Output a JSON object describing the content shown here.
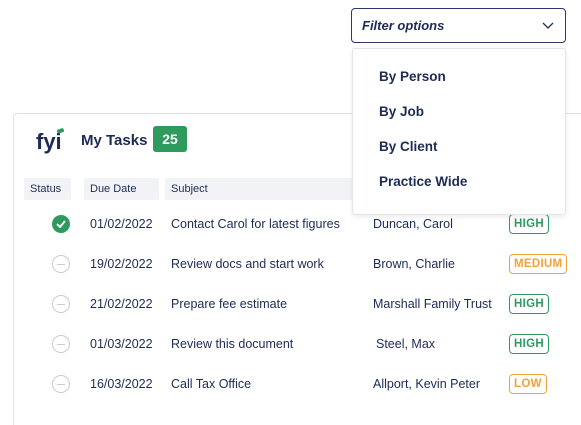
{
  "filter": {
    "label": "Filter options",
    "options": [
      "By Person",
      "By Job",
      "By Client",
      "Practice Wide"
    ]
  },
  "panel": {
    "logo_text": "fyi",
    "title": "My Tasks",
    "count": "25",
    "columns": [
      "Status",
      "Due Date",
      "Subject"
    ]
  },
  "tasks": [
    {
      "status": "completed",
      "status_icon": "check-circle-icon",
      "due": "01/02/2022",
      "subject": "Contact Carol for latest figures",
      "person": "Duncan, Carol",
      "priority": "HIGH"
    },
    {
      "status": "open",
      "status_icon": "empty-circle-icon",
      "due": "19/02/2022",
      "subject": "Review docs and start work",
      "person": "Brown, Charlie",
      "priority": "MEDIUM"
    },
    {
      "status": "open",
      "status_icon": "empty-circle-icon",
      "due": "21/02/2022",
      "subject": "Prepare fee estimate",
      "person": "Marshall Family Trust",
      "priority": "HIGH"
    },
    {
      "status": "open",
      "status_icon": "empty-circle-icon",
      "due": "01/03/2022",
      "subject": "Review this document",
      "person": "Steel, Max",
      "priority": "HIGH"
    },
    {
      "status": "open",
      "status_icon": "empty-circle-icon",
      "due": "16/03/2022",
      "subject": "Call Tax Office",
      "person": "Allport, Kevin Peter",
      "priority": "LOW"
    }
  ],
  "colors": {
    "navy": "#1d2b55",
    "green": "#2f9a5e",
    "high": "#2f9a5e",
    "medium": "#f2a23a",
    "low": "#f2a23a"
  }
}
